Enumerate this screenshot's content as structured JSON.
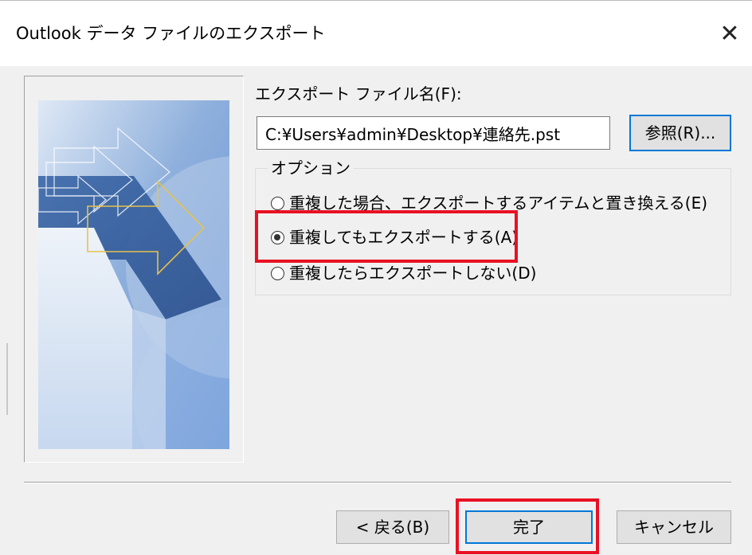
{
  "window": {
    "title": "Outlook データ ファイルのエクスポート",
    "close_label": "✕"
  },
  "export_file": {
    "label": "エクスポート ファイル名(F):",
    "path_value": "C:¥Users¥admin¥Desktop¥連絡先.pst",
    "browse_label": "参照(R)..."
  },
  "options": {
    "group_label": "オプション",
    "radios": [
      {
        "label": "重複した場合、エクスポートするアイテムと置き換える(E)",
        "checked": false
      },
      {
        "label": "重複してもエクスポートする(A)",
        "checked": true
      },
      {
        "label": "重複したらエクスポートしない(D)",
        "checked": false
      }
    ]
  },
  "buttons": {
    "back_label": "< 戻る(B)",
    "finish_label": "完了",
    "cancel_label": "キャンセル"
  },
  "colors": {
    "highlight": "#e81123",
    "focus_border": "#0078d7",
    "dialog_bg": "#f0f0f0"
  }
}
